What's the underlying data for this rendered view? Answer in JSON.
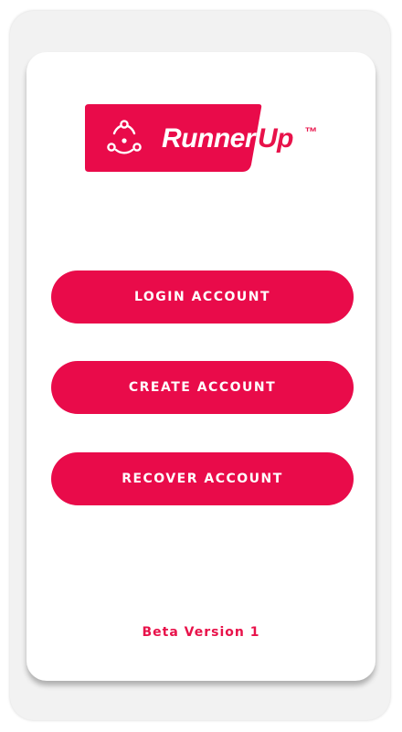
{
  "brand": {
    "name_part1": "Runner",
    "name_part2": "Up",
    "trademark": "™",
    "icon": "share-nodes-icon",
    "primary_color": "#e90b4a"
  },
  "actions": {
    "login_label": "LOGIN ACCOUNT",
    "create_label": "CREATE ACCOUNT",
    "recover_label": "RECOVER ACCOUNT"
  },
  "footer": {
    "version_text": "Beta Version 1"
  }
}
